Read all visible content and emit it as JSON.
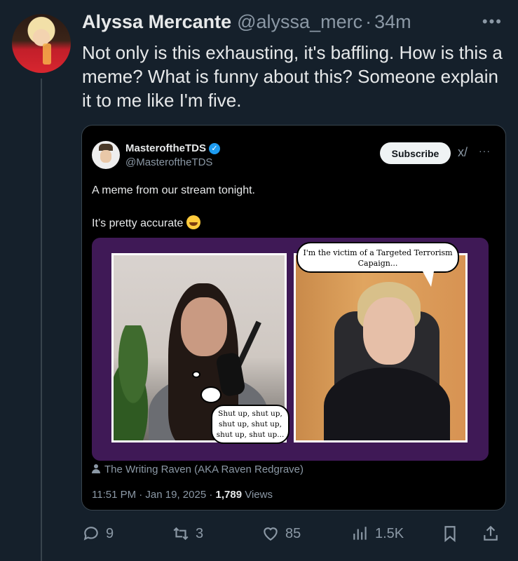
{
  "tweet": {
    "author_name": "Alyssa Mercante",
    "author_handle": "@alyssa_merc",
    "separator": "·",
    "time": "34m",
    "more": "•••",
    "text": "Not only is this exhausting, it's baffling. How is this a meme? What is funny about this? Someone explain it to me like I'm five."
  },
  "embed": {
    "author_name": "MasteroftheTDS",
    "author_handle": "@MasteroftheTDS",
    "subscribe_label": "Subscribe",
    "grok_label": "x/",
    "more": "···",
    "text_line1": "A meme from our stream tonight.",
    "text_line2": "It’s pretty accurate",
    "meme": {
      "bubble_right": "I'm the victim of a Targeted Terrorism Capaign...",
      "bubble_left": "Shut up, shut up, shut up, shut up, shut up, shut up..."
    },
    "credit": "The Writing Raven (AKA Raven Redgrave)",
    "time_date": "11:51 PM · Jan 19, 2025 · ",
    "views_count": "1,789",
    "views_label": " Views"
  },
  "actions": {
    "reply_count": "9",
    "retweet_count": "3",
    "like_count": "85",
    "views_count": "1.5K"
  },
  "colors": {
    "background": "#15202b",
    "text": "#e7e9ea",
    "muted": "#8b98a5",
    "verified": "#1d9bf0",
    "meme_bg": "#3f1956"
  }
}
